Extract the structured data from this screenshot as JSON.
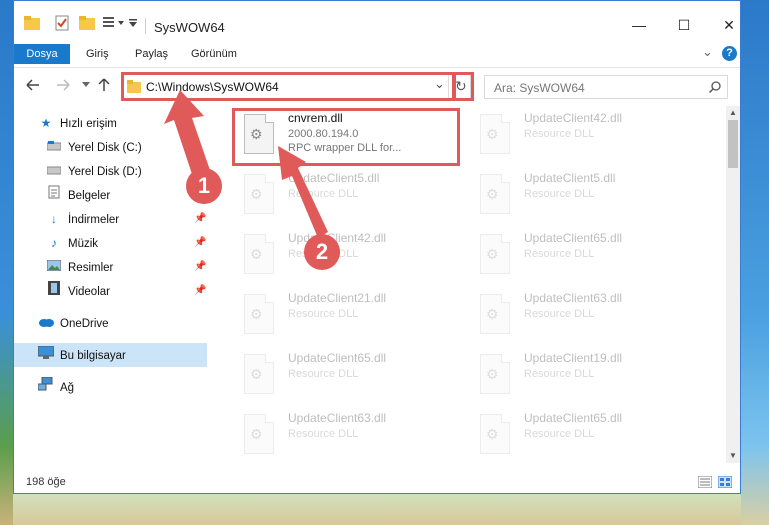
{
  "window": {
    "title": "SysWOW64",
    "minimize_glyph": "—",
    "maximize_glyph": "☐",
    "close_glyph": "✕"
  },
  "ribbon": {
    "tabs": [
      {
        "label": "Dosya",
        "active": true
      },
      {
        "label": "Giriş",
        "active": false
      },
      {
        "label": "Paylaş",
        "active": false
      },
      {
        "label": "Görünüm",
        "active": false
      }
    ],
    "collapse_glyph": "⌄",
    "help_glyph": "?"
  },
  "address": {
    "path": "C:\\Windows\\SysWOW64",
    "dropdown_glyph": "⌄",
    "refresh_glyph": "↻"
  },
  "search": {
    "placeholder": "Ara: SysWOW64",
    "icon": "search-icon"
  },
  "sidebar": {
    "items": [
      {
        "label": "Hızlı erişim",
        "icon": "star-icon",
        "pinned": false
      },
      {
        "label": "Yerel Disk (C:)",
        "icon": "drive-icon",
        "pinned": true
      },
      {
        "label": "Yerel Disk (D:)",
        "icon": "drive-icon",
        "pinned": true
      },
      {
        "label": "Belgeler",
        "icon": "documents-icon",
        "pinned": true
      },
      {
        "label": "İndirmeler",
        "icon": "download-icon",
        "pinned": true
      },
      {
        "label": "Müzik",
        "icon": "music-icon",
        "pinned": true
      },
      {
        "label": "Resimler",
        "icon": "pictures-icon",
        "pinned": true
      },
      {
        "label": "Videolar",
        "icon": "video-icon",
        "pinned": true
      },
      {
        "label": "OneDrive",
        "icon": "cloud-icon",
        "pinned": false
      },
      {
        "label": "Bu bilgisayar",
        "icon": "computer-icon",
        "pinned": false,
        "selected": true
      },
      {
        "label": "Ağ",
        "icon": "network-icon",
        "pinned": false
      }
    ]
  },
  "files": {
    "highlighted": {
      "name": "cnvrem.dll",
      "version": "2000.80.194.0",
      "desc": "RPC wrapper DLL for..."
    },
    "faded": [
      {
        "name": "UpdateClient42.dll",
        "desc": "Resource DLL"
      },
      {
        "name": "UpdateClient5.dll",
        "desc": "Resource DLL"
      },
      {
        "name": "UpdateClient5.dll",
        "desc": "Resource DLL"
      },
      {
        "name": "UpdateClient42.dll",
        "desc": "Resource DLL"
      },
      {
        "name": "UpdateClient65.dll",
        "desc": "Resource DLL"
      },
      {
        "name": "UpdateClient21.dll",
        "desc": "Resource DLL"
      },
      {
        "name": "UpdateClient63.dll",
        "desc": "Resource DLL"
      },
      {
        "name": "UpdateClient65.dll",
        "desc": "Resource DLL"
      },
      {
        "name": "UpdateClient19.dll",
        "desc": "Resource DLL"
      },
      {
        "name": "UpdateClient63.dll",
        "desc": "Resource DLL"
      },
      {
        "name": "UpdateClient65.dll",
        "desc": "Resource DLL"
      }
    ]
  },
  "status": {
    "count": "198 öğe"
  },
  "annotations": {
    "step1": "1",
    "step2": "2",
    "color": "#e05a5a"
  }
}
